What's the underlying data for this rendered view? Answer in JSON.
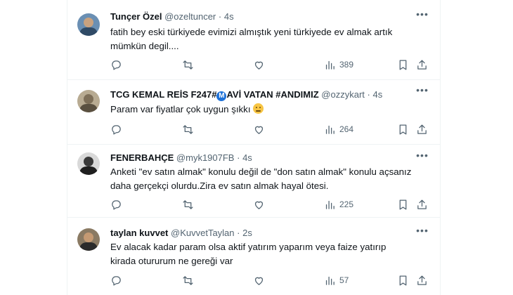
{
  "tweets": [
    {
      "name": "Tunçer Özel",
      "handle": "@ozeltuncer",
      "dot": "·",
      "time": "4s",
      "text": "fatih bey eski türkiyede evimizi almıştık yeni türkiyede ev almak artık mümkün degil....",
      "views": "389"
    },
    {
      "name_a": "TCG KEMAL REİS F247#",
      "badge": "M",
      "name_b": "AVİ VATAN #ANDIMIZ",
      "handle": "@ozzykart",
      "dot": "·",
      "time": "4s",
      "text": "Param var fiyatlar çok uygun şıkkı",
      "emoji": "thinking-face",
      "views": "264"
    },
    {
      "name": "FENERBAHÇE",
      "handle": "@myk1907FB",
      "dot": "·",
      "time": "4s",
      "text": "Anketi \"ev satın almak\" konulu değil de \"don satın almak\" konulu açsanız daha gerçekçi olurdu.Zira ev satın almak hayal ötesi.",
      "views": "225"
    },
    {
      "name": "taylan kuvvet",
      "handle": "@KuvvetTaylan",
      "dot": "·",
      "time": "2s",
      "text": "Ev alacak kadar param olsa aktif yatırım yaparım veya faize yatırıp kirada otururum ne gereği var",
      "views": "57"
    }
  ],
  "icons": {
    "more": "more-dots-icon",
    "reply": "reply-icon",
    "retweet": "retweet-icon",
    "like": "heart-icon",
    "views": "views-bar-icon",
    "bookmark": "bookmark-icon",
    "share": "share-icon"
  },
  "colors": {
    "muted": "#536471",
    "text": "#0f1419",
    "divider": "#eff3f4",
    "badge": "#1d71d8"
  }
}
